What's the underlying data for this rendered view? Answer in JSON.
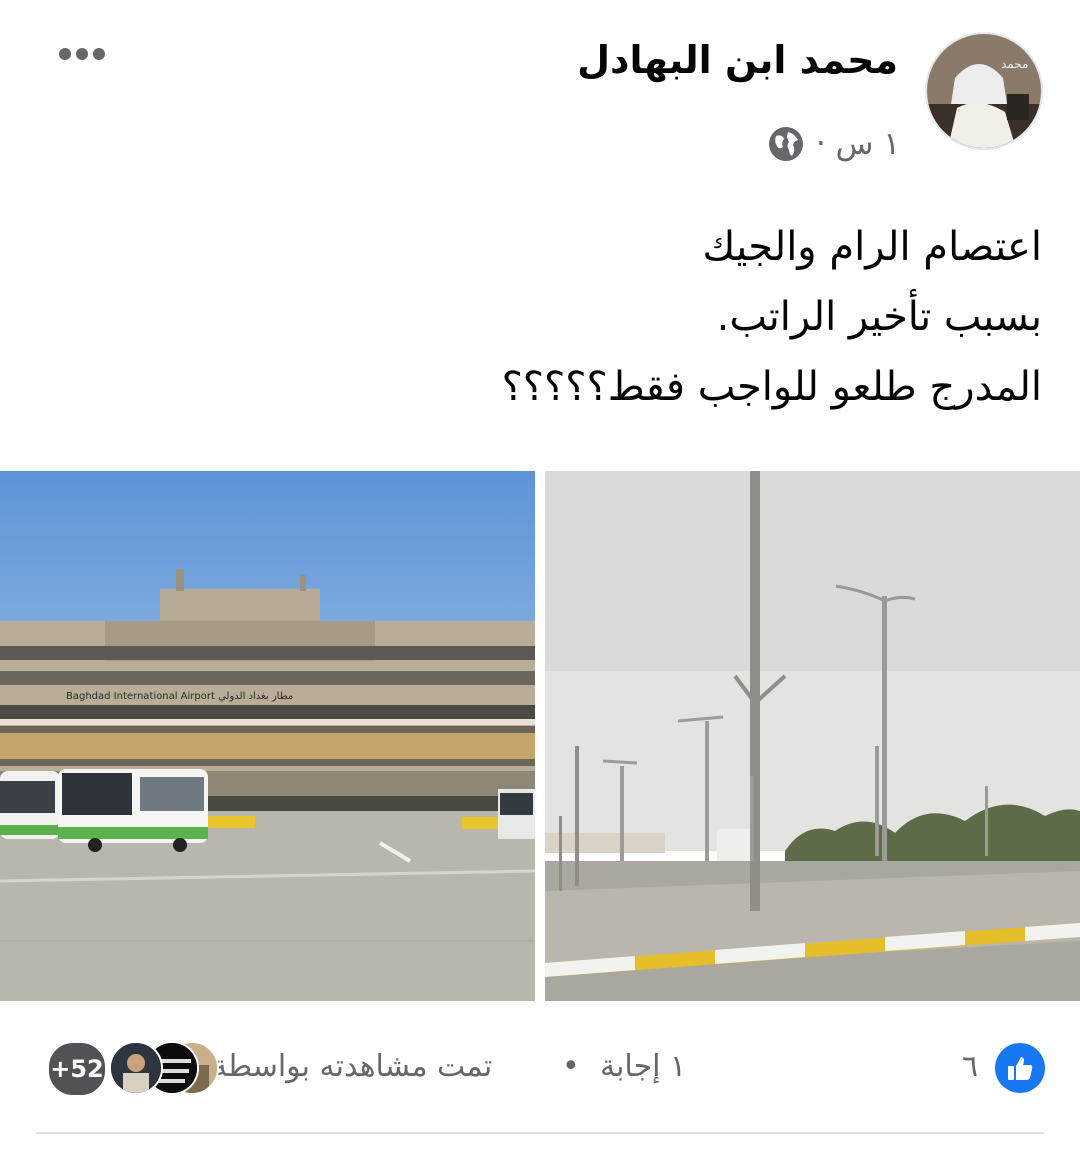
{
  "post": {
    "author": "محمد ابن البهادل",
    "time": "١ س ·",
    "text_lines": [
      "اعتصام الرام والجيك",
      "بسبب تأخير الراتب.",
      "المدرج طلعو للواجب فقط؟؟؟؟؟"
    ],
    "photo_left_sign": "Baghdad International Airport   مطار بغداد الدولي"
  },
  "footer": {
    "like_count": "٦",
    "replies": "١ إجابة",
    "separator": "•",
    "seen_by": "تمت مشاهدته بواسطة",
    "seen_more": "+52"
  },
  "colors": {
    "accent": "#1877f2",
    "secondary_text": "#65676b"
  },
  "icons": [
    "more-options-icon",
    "globe-icon",
    "like-icon"
  ]
}
